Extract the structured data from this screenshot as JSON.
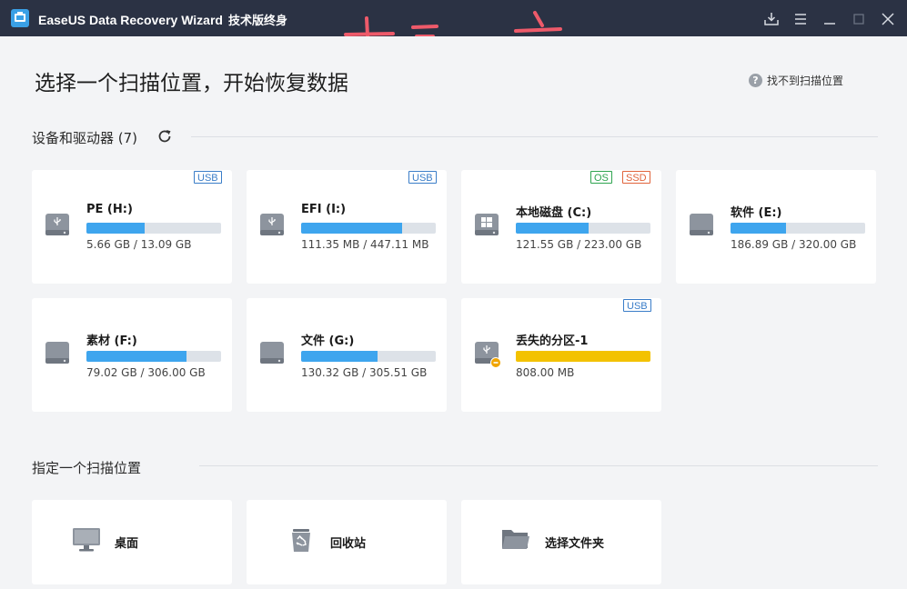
{
  "window": {
    "title": "EaseUS Data Recovery Wizard",
    "edition": "技术版终身",
    "controls": [
      "download-icon",
      "menu-icon",
      "minimize-icon",
      "maximize-icon",
      "close-icon"
    ]
  },
  "page": {
    "title": "选择一个扫描位置，开始恢复数据",
    "help_link": "找不到扫描位置"
  },
  "devices_section": {
    "heading": "设备和驱动器 (7)",
    "drives": [
      {
        "name": "PE (H:)",
        "size": "5.66 GB / 13.09 GB",
        "used_fraction": 0.43,
        "tags": [
          "USB"
        ],
        "icon": "usb-drive-icon",
        "bar_color": "#3ea5ee"
      },
      {
        "name": "EFI (I:)",
        "size": "111.35 MB / 447.11 MB",
        "used_fraction": 0.75,
        "tags": [
          "USB"
        ],
        "icon": "usb-drive-icon",
        "bar_color": "#3ea5ee"
      },
      {
        "name": "本地磁盘 (C:)",
        "size": "121.55 GB / 223.00 GB",
        "used_fraction": 0.54,
        "tags": [
          "OS",
          "SSD"
        ],
        "icon": "windows-drive-icon",
        "bar_color": "#3ea5ee"
      },
      {
        "name": "软件 (E:)",
        "size": "186.89 GB / 320.00 GB",
        "used_fraction": 0.41,
        "tags": [],
        "icon": "hard-drive-icon",
        "bar_color": "#3ea5ee"
      },
      {
        "name": "素材 (F:)",
        "size": "79.02 GB / 306.00 GB",
        "used_fraction": 0.74,
        "tags": [],
        "icon": "hard-drive-icon",
        "bar_color": "#3ea5ee"
      },
      {
        "name": "文件 (G:)",
        "size": "130.32 GB / 305.51 GB",
        "used_fraction": 0.57,
        "tags": [],
        "icon": "hard-drive-icon",
        "bar_color": "#3ea5ee"
      },
      {
        "name": "丢失的分区-1",
        "size": "808.00 MB",
        "used_fraction": 1.0,
        "tags": [
          "USB"
        ],
        "icon": "lost-partition-icon",
        "bar_color": "#f3c200"
      }
    ]
  },
  "location_section": {
    "heading": "指定一个扫描位置",
    "items": [
      {
        "label": "桌面",
        "icon": "desktop-icon"
      },
      {
        "label": "回收站",
        "icon": "recycle-bin-icon"
      },
      {
        "label": "选择文件夹",
        "icon": "folder-icon"
      }
    ]
  },
  "colors": {
    "titlebar": "#2b3244",
    "accent": "#3ea5ee",
    "lost_partition": "#f3c200",
    "handwriting": "#ee5a6a"
  }
}
